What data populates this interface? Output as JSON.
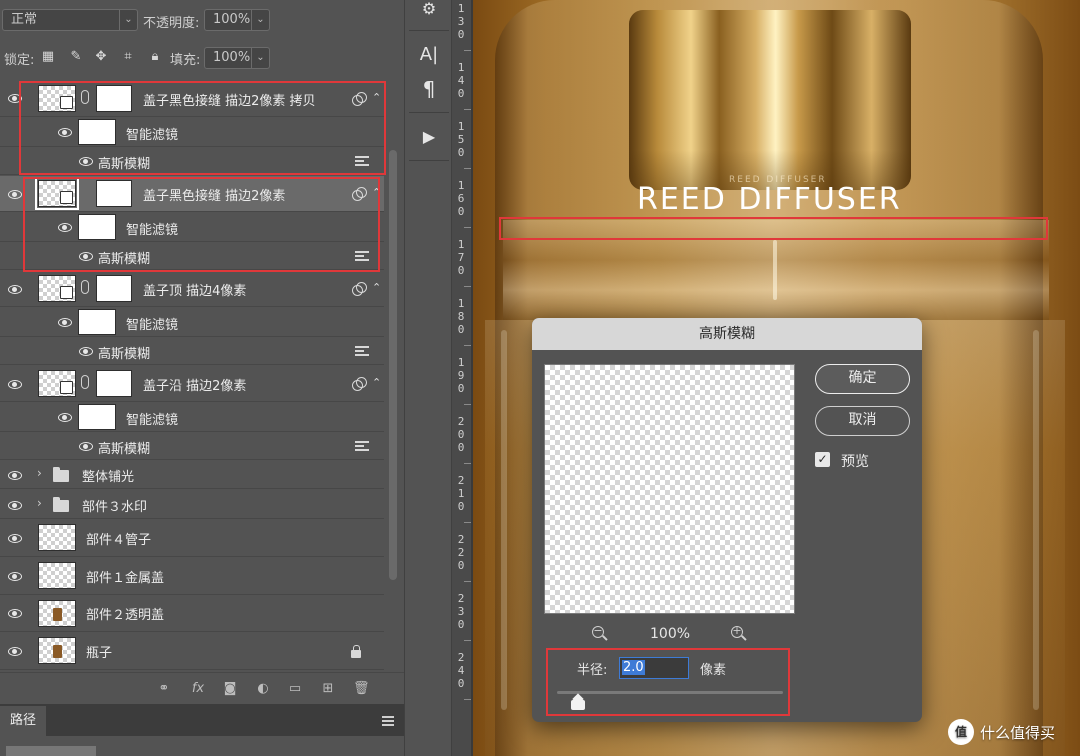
{
  "layers_panel": {
    "blend_mode": "正常",
    "opacity_label": "不透明度:",
    "opacity_value": "100%",
    "lock_label": "锁定:",
    "fill_label": "填充:",
    "fill_value": "100%",
    "layers": [
      {
        "name": "盖子黑色接缝 描边2像素 拷贝",
        "type": "smart-object",
        "visible": true
      },
      {
        "name": "智能滤镜",
        "type": "smart-filters",
        "visible": true
      },
      {
        "name": "高斯模糊",
        "type": "filter",
        "visible": true
      },
      {
        "name": "盖子黑色接缝 描边2像素",
        "type": "smart-object",
        "visible": true,
        "selected": true
      },
      {
        "name": "智能滤镜",
        "type": "smart-filters",
        "visible": true
      },
      {
        "name": "高斯模糊",
        "type": "filter",
        "visible": true
      },
      {
        "name": "盖子顶 描边4像素",
        "type": "smart-object",
        "visible": true
      },
      {
        "name": "智能滤镜",
        "type": "smart-filters",
        "visible": true
      },
      {
        "name": "高斯模糊",
        "type": "filter",
        "visible": true
      },
      {
        "name": "盖子沿 描边2像素",
        "type": "smart-object",
        "visible": true
      },
      {
        "name": "智能滤镜",
        "type": "smart-filters",
        "visible": true
      },
      {
        "name": "高斯模糊",
        "type": "filter",
        "visible": true
      },
      {
        "name": "整体铺光",
        "type": "group",
        "visible": true
      },
      {
        "name": "部件３水印",
        "type": "group",
        "visible": true
      },
      {
        "name": "部件４管子",
        "type": "pixel",
        "visible": true
      },
      {
        "name": "部件１金属盖",
        "type": "pixel",
        "visible": true
      },
      {
        "name": "部件２透明盖",
        "type": "pixel",
        "visible": true
      },
      {
        "name": "瓶子",
        "type": "pixel",
        "visible": true,
        "locked": true
      }
    ]
  },
  "paths_panel": {
    "tab_label": "路径"
  },
  "tools": {
    "type_label": "A|",
    "paragraph_label": "¶"
  },
  "ruler": {
    "labels": [
      "13",
      "0",
      "14",
      "0",
      "15",
      "0",
      "16",
      "0",
      "17",
      "0",
      "18",
      "0",
      "19",
      "0",
      "20",
      "0",
      "21",
      "0",
      "22",
      "0",
      "23",
      "0",
      "24",
      "0"
    ]
  },
  "canvas": {
    "brand_small": "REED DIFFUSER",
    "brand_large": "REED DIFFUSER"
  },
  "dialog": {
    "title": "高斯模糊",
    "ok_label": "确定",
    "cancel_label": "取消",
    "preview_label": "预览",
    "preview_checked": true,
    "zoom_level": "100%",
    "zoom_out_sign": "−",
    "zoom_in_sign": "+",
    "radius_label": "半径:",
    "radius_value": "2.0",
    "radius_unit": "像素"
  },
  "watermark": {
    "logo_text": "值",
    "text": "什么值得买"
  }
}
